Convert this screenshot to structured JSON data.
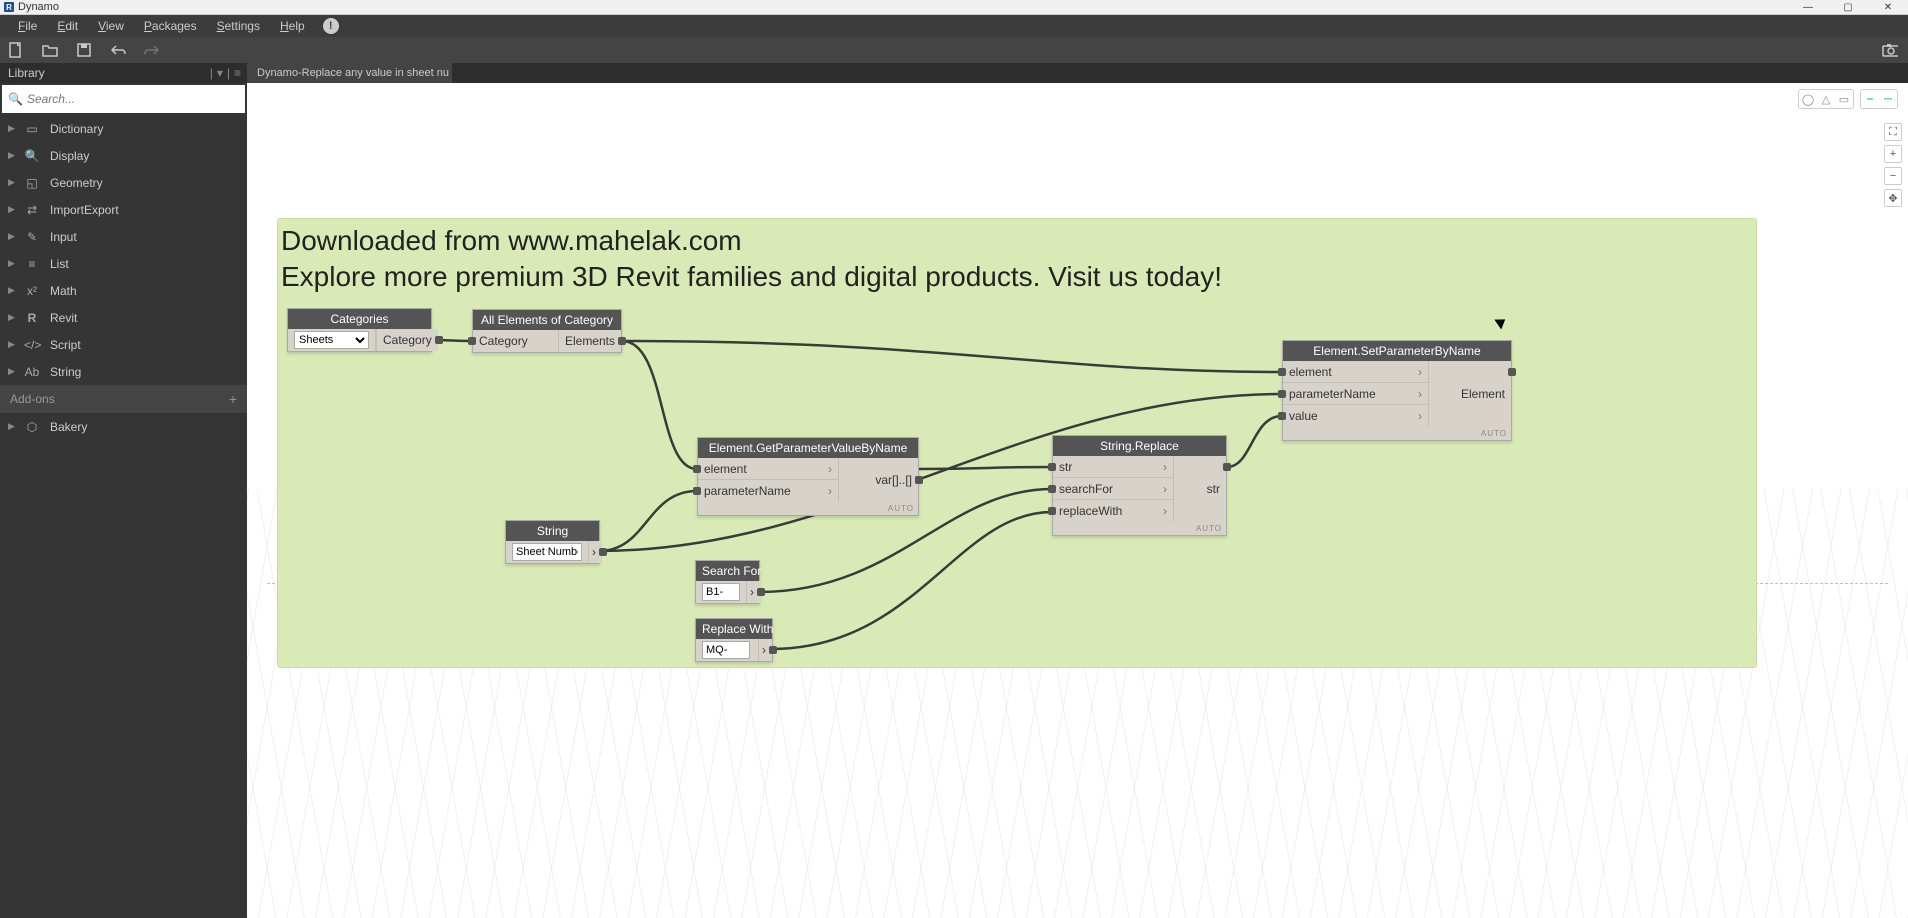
{
  "window": {
    "title": "Dynamo"
  },
  "menu": {
    "file": "File",
    "edit": "Edit",
    "view": "View",
    "packages": "Packages",
    "settings": "Settings",
    "help": "Help"
  },
  "library": {
    "header": "Library",
    "search_placeholder": "Search...",
    "items": [
      {
        "icon": "book",
        "label": "Dictionary"
      },
      {
        "icon": "mag",
        "label": "Display"
      },
      {
        "icon": "cube",
        "label": "Geometry"
      },
      {
        "icon": "swap",
        "label": "ImportExport"
      },
      {
        "icon": "pencil",
        "label": "Input"
      },
      {
        "icon": "list",
        "label": "List"
      },
      {
        "icon": "x2",
        "label": "Math"
      },
      {
        "icon": "R",
        "label": "Revit"
      },
      {
        "icon": "code",
        "label": "Script"
      },
      {
        "icon": "Ab",
        "label": "String"
      }
    ],
    "addons_header": "Add-ons",
    "addons": [
      {
        "icon": "hex",
        "label": "Bakery"
      }
    ]
  },
  "tab": {
    "title": "Dynamo-Replace any value in sheet nu"
  },
  "watermark": {
    "l1": "Downloaded from www.mahelak.com",
    "l2": "Explore more premium 3D Revit families and digital products. Visit us today!"
  },
  "nodes": {
    "categories": {
      "title": "Categories",
      "value": "Sheets",
      "out": "Category"
    },
    "allElementsOfCategory": {
      "title": "All Elements of Category",
      "in": "Category",
      "out": "Elements"
    },
    "getParamVal": {
      "title": "Element.GetParameterValueByName",
      "in1": "element",
      "in2": "parameterName",
      "out": "var[]..[]",
      "auto": "AUTO"
    },
    "string": {
      "title": "String",
      "value": "Sheet Number"
    },
    "searchFor": {
      "title": "Search For",
      "value": "B1-"
    },
    "replaceWith": {
      "title": "Replace With",
      "value": "MQ-"
    },
    "stringReplace": {
      "title": "String.Replace",
      "in1": "str",
      "in2": "searchFor",
      "in3": "replaceWith",
      "out": "str",
      "auto": "AUTO"
    },
    "setParam": {
      "title": "Element.SetParameterByName",
      "in1": "element",
      "in2": "parameterName",
      "in3": "value",
      "out": "Element",
      "auto": "AUTO"
    }
  }
}
